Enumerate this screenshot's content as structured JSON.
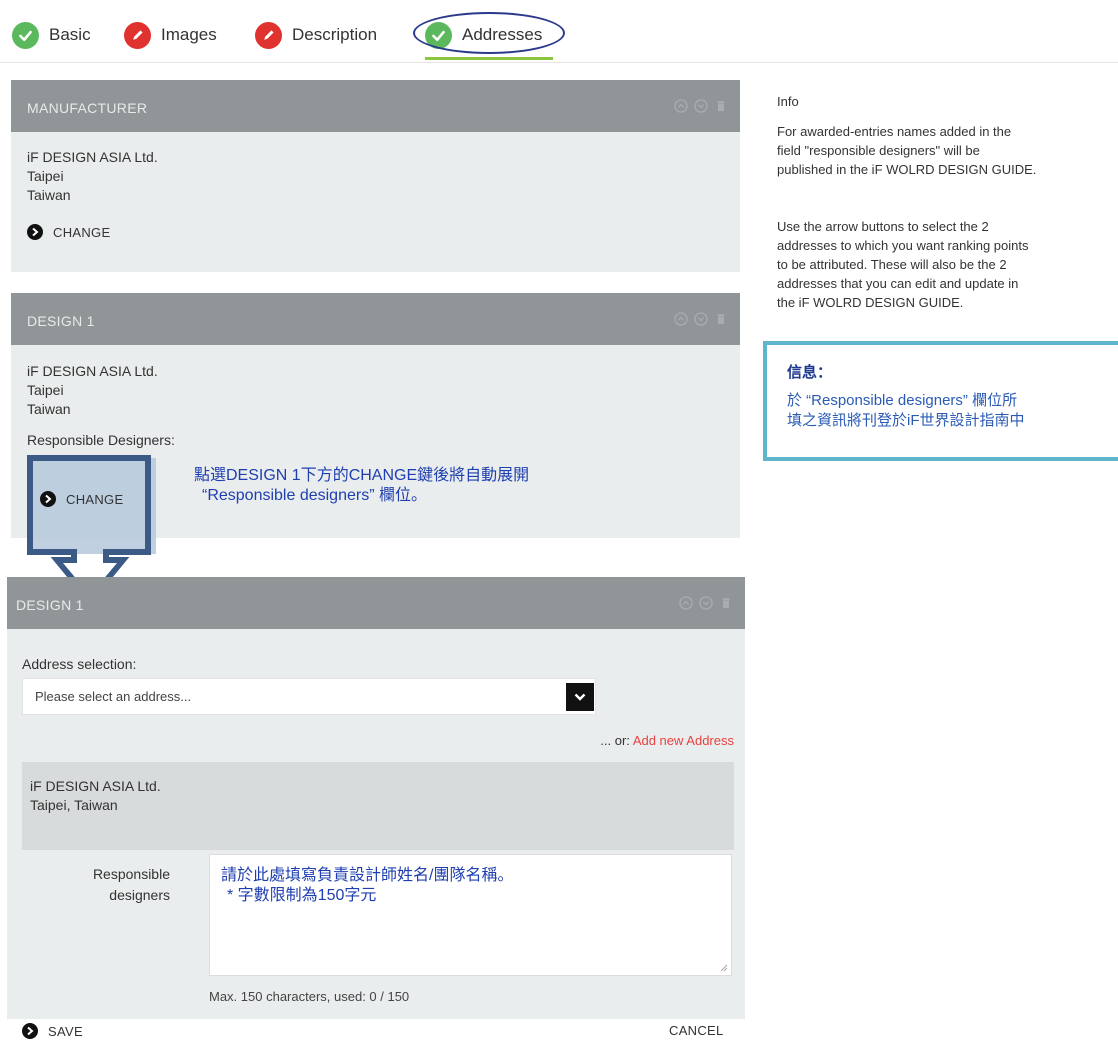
{
  "tabs": [
    {
      "label": "Basic",
      "status": "complete"
    },
    {
      "label": "Images",
      "status": "incomplete"
    },
    {
      "label": "Description",
      "status": "incomplete"
    },
    {
      "label": "Addresses",
      "status": "complete"
    }
  ],
  "colors": {
    "complete": "#5cb85c",
    "incomplete": "#e0322f",
    "header": "#909598",
    "panel": "#eaeded",
    "annotation_blue": "#1f3fb0",
    "link_red": "#e84141"
  },
  "manufacturer": {
    "title": "MANUFACTURER",
    "lines": [
      "iF DESIGN ASIA Ltd.",
      "Taipei",
      "Taiwan"
    ],
    "change_label": "CHANGE"
  },
  "design1": {
    "title": "DESIGN 1",
    "lines": [
      "iF DESIGN ASIA Ltd.",
      "Taipei",
      "Taiwan"
    ],
    "responsible_label": "Responsible Designers:",
    "change_label": "CHANGE"
  },
  "annotation": {
    "line1": "點選DESIGN 1下方的CHANGE鍵後將自動展開",
    "line2": "“Responsible designers” 欄位。"
  },
  "expanded": {
    "title": "DESIGN 1",
    "address_selection_label": "Address selection:",
    "select_placeholder": "Please select an address...",
    "or_label": "... or:",
    "add_new_label": "Add new Address",
    "address_lines": [
      "iF DESIGN ASIA Ltd.",
      "Taipei,  Taiwan"
    ],
    "responsible_label_1": "Responsible",
    "responsible_label_2": "designers",
    "textarea_hint_1": "請於此處填寫負責設計師姓名/團隊名稱。",
    "textarea_hint_2": "* 字數限制為150字元",
    "counter": "Max. 150 characters, used: 0 / 150",
    "save_label": "SAVE",
    "cancel_label": "CANCEL"
  },
  "info": {
    "title": "Info",
    "p1": [
      "For awarded-entries names added in the",
      "field \"responsible designers\" will be",
      "published in the iF WOLRD DESIGN GUIDE."
    ],
    "p2": [
      "Use the arrow buttons to select the 2",
      "addresses to which you want ranking points",
      "to be attributed. These will also be the 2",
      "addresses that you can edit and update in",
      "the iF WOLRD DESIGN GUIDE."
    ]
  },
  "info_cn": {
    "title": "信息：",
    "line1": "於 “Responsible designers” 欄位所",
    "line2": "填之資訊將刊登於iF世界設計指南中"
  },
  "icons": {
    "complete": "check-icon",
    "incomplete": "pencil-icon",
    "header_actions": [
      "chevron-up-icon",
      "chevron-down-icon",
      "trash-icon"
    ]
  }
}
